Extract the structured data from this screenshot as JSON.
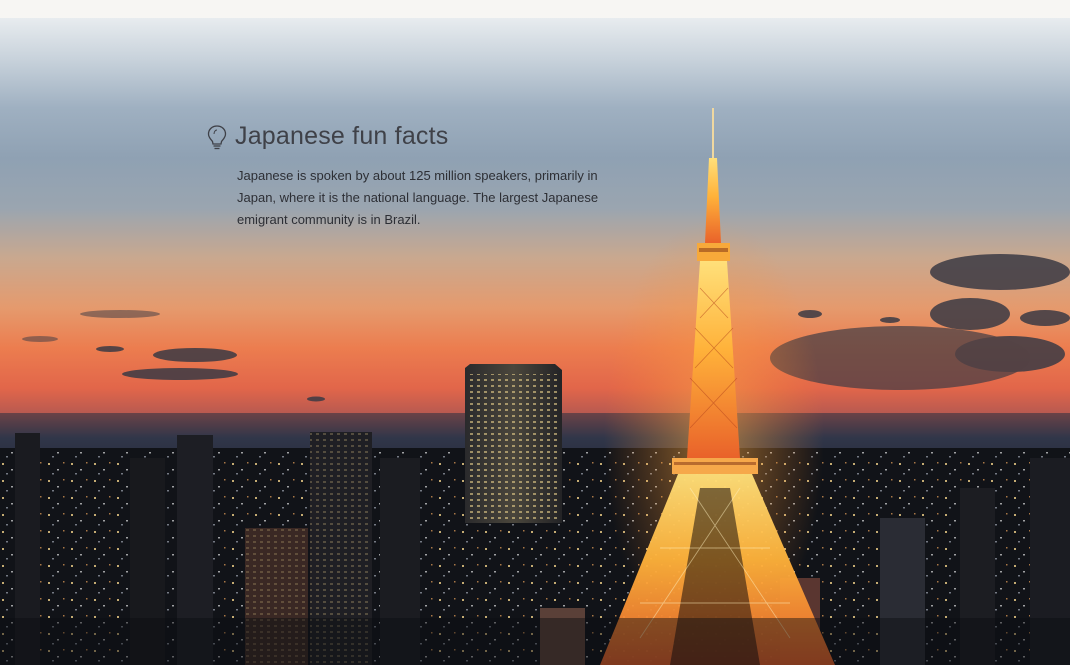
{
  "fun_facts": {
    "title": "Japanese fun facts",
    "icon": "lightbulb-icon",
    "text": "Japanese is spoken by about 125 million speakers, primarily in Japan, where it is the national language. The largest Japanese emigrant community is in Brazil."
  },
  "colors": {
    "title_text": "#3f4148",
    "body_text": "#2d2f35",
    "tower_glow": "#f08a3c",
    "sky_orange": "#ec7d4f"
  }
}
